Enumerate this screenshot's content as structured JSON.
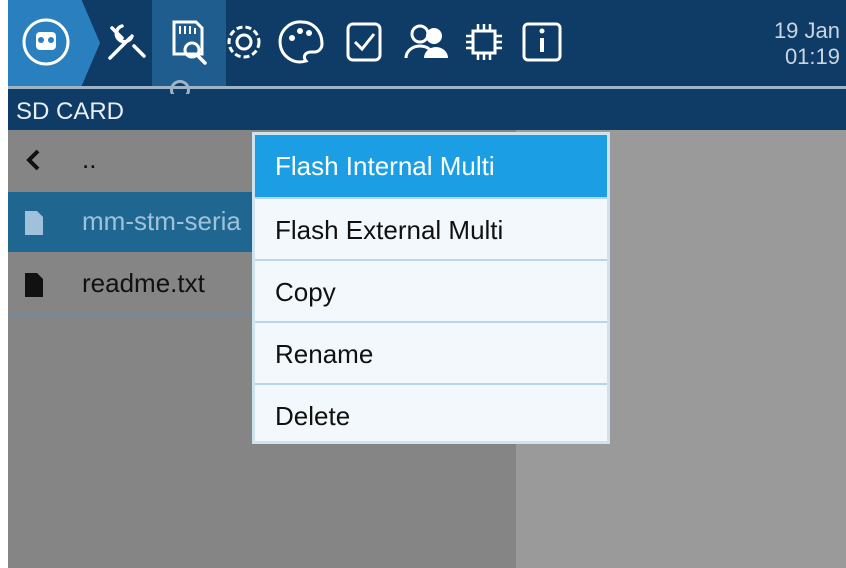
{
  "status": {
    "date": "19 Jan",
    "time": "01:19"
  },
  "toolbar": {
    "icons": [
      "home-icon",
      "tools-icon",
      "sd-card-icon",
      "gear-icon",
      "palette-icon",
      "checklist-icon",
      "users-icon",
      "chip-icon",
      "info-icon"
    ]
  },
  "header": {
    "title": "SD CARD"
  },
  "files": [
    {
      "label": "..",
      "type": "parent"
    },
    {
      "label": "mm-stm-seria",
      "type": "file",
      "selected": true
    },
    {
      "label": "readme.txt",
      "type": "file"
    }
  ],
  "context_menu": {
    "items": [
      "Flash Internal Multi",
      "Flash External Multi",
      "Copy",
      "Rename",
      "Delete"
    ],
    "active_index": 0
  },
  "colors": {
    "accent": "#1b9ee3",
    "topbar": "#0f3c66",
    "selected_row": "#1f6691"
  }
}
